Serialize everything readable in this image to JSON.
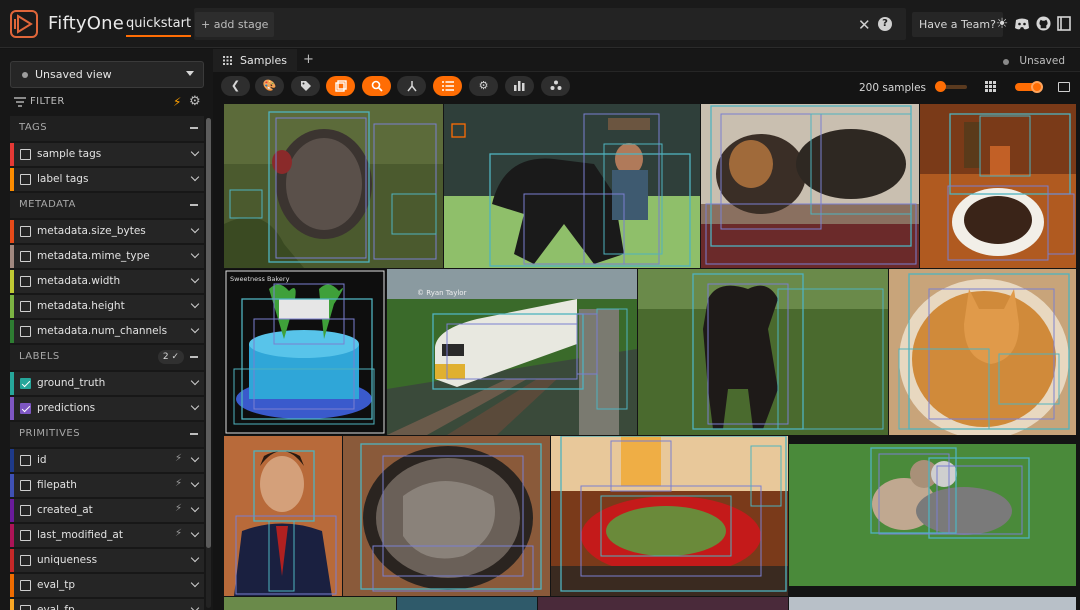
{
  "app": {
    "brand": "FiftyOne",
    "dataset": "quickstart",
    "add_stage": "+ add stage",
    "team_button": "Have a Team?"
  },
  "sidebar": {
    "view_select": "Unsaved view",
    "filter_label": "FILTER",
    "sections": [
      {
        "title": "TAGS",
        "items": [
          {
            "label": "sample tags",
            "color": "#e53935",
            "checked": false
          },
          {
            "label": "label tags",
            "color": "#fb8c00",
            "checked": false
          }
        ]
      },
      {
        "title": "METADATA",
        "items": [
          {
            "label": "metadata.size_bytes",
            "color": "#e64a19"
          },
          {
            "label": "metadata.mime_type",
            "color": "#a1887f"
          },
          {
            "label": "metadata.width",
            "color": "#c0ca33"
          },
          {
            "label": "metadata.height",
            "color": "#7cb342"
          },
          {
            "label": "metadata.num_channels",
            "color": "#2e7d32"
          }
        ]
      },
      {
        "title": "LABELS",
        "badge": "2 ✓",
        "items": [
          {
            "label": "ground_truth",
            "color": "#26a69a",
            "checked": true
          },
          {
            "label": "predictions",
            "color": "#7e57c2",
            "checked": true
          }
        ]
      },
      {
        "title": "PRIMITIVES",
        "items": [
          {
            "label": "id",
            "color": "#1e3a8a",
            "bolt": true
          },
          {
            "label": "filepath",
            "color": "#3f51b5",
            "bolt": true
          },
          {
            "label": "created_at",
            "color": "#6a1b9a",
            "bolt": true
          },
          {
            "label": "last_modified_at",
            "color": "#ad1457",
            "bolt": true
          },
          {
            "label": "uniqueness",
            "color": "#c62828"
          },
          {
            "label": "eval_tp",
            "color": "#ef6c00"
          },
          {
            "label": "eval_fp",
            "color": "#f9a825"
          }
        ]
      }
    ]
  },
  "main": {
    "tab_label": "Samples",
    "unsaved": "Unsaved",
    "sample_count": "200 samples",
    "photo_credit": "© Ryan Taylor",
    "cake_caption": "Sweetness Bakery"
  },
  "colors": {
    "accent": "#ff6d04",
    "box_a": "#4fb3bf",
    "box_b": "#7a7fd0"
  }
}
